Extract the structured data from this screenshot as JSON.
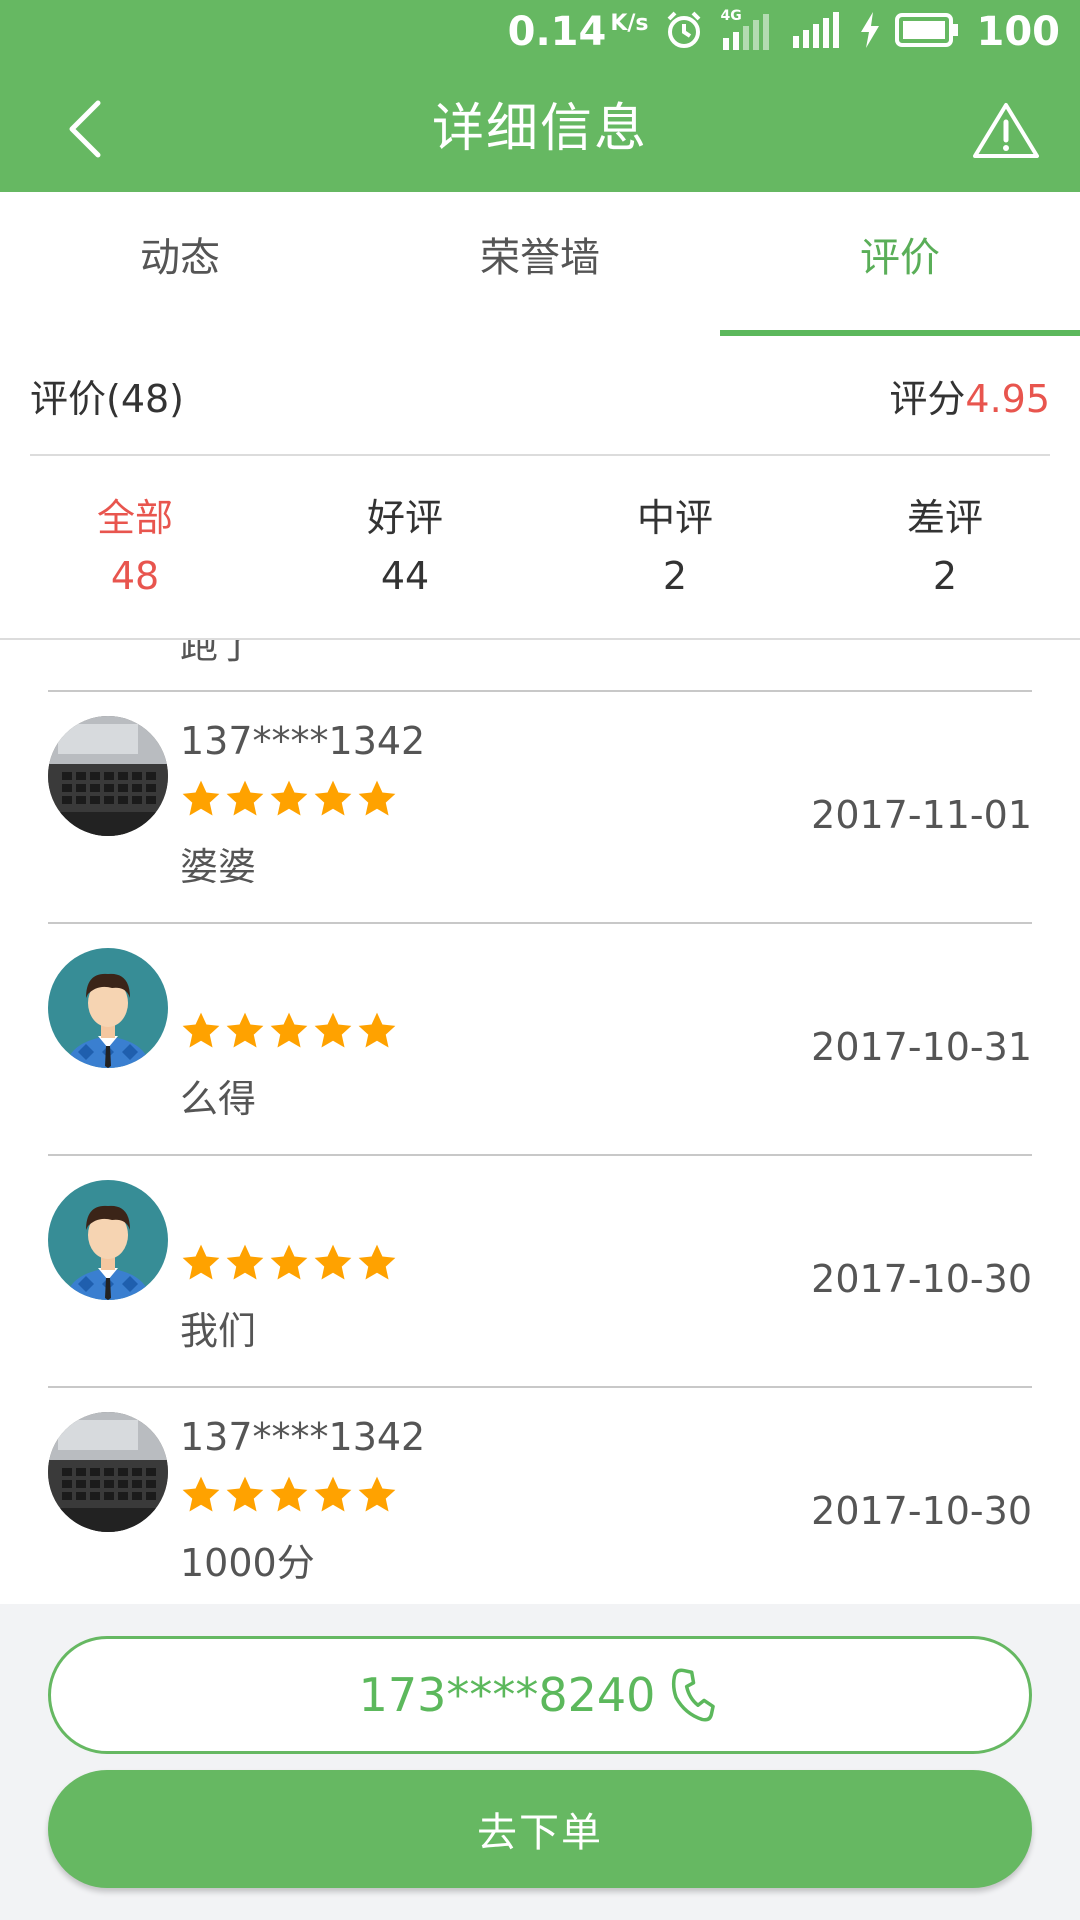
{
  "status_bar": {
    "net_speed": "0.14",
    "net_speed_unit": "K/s",
    "network_type": "4G",
    "battery": "100",
    "icons": [
      "alarm-icon",
      "signal-4g-icon",
      "signal-icon",
      "charging-icon",
      "battery-icon"
    ]
  },
  "header": {
    "title": "详细信息",
    "back_icon": "chevron-left-icon",
    "report_icon": "warning-triangle-icon"
  },
  "tabs": [
    {
      "label": "动态",
      "active": false
    },
    {
      "label": "荣誉墙",
      "active": false
    },
    {
      "label": "评价",
      "active": true
    }
  ],
  "summary": {
    "reviews_label": "评价(48)",
    "score_label": "评分",
    "score_value": "4.95"
  },
  "filters": [
    {
      "label": "全部",
      "count": "48",
      "active": true
    },
    {
      "label": "好评",
      "count": "44",
      "active": false
    },
    {
      "label": "中评",
      "count": "2",
      "active": false
    },
    {
      "label": "差评",
      "count": "2",
      "active": false
    }
  ],
  "partial_text": "跑了",
  "reviews": [
    {
      "user": "137****1342",
      "avatar": "laptop-photo",
      "stars": 5,
      "date": "2017-11-01",
      "text": "婆婆"
    },
    {
      "user": "",
      "avatar": "default-man",
      "stars": 5,
      "date": "2017-10-31",
      "text": "么得"
    },
    {
      "user": "",
      "avatar": "default-man",
      "stars": 5,
      "date": "2017-10-30",
      "text": "我们"
    },
    {
      "user": "137****1342",
      "avatar": "laptop-photo",
      "stars": 5,
      "date": "2017-10-30",
      "text": "1000分"
    }
  ],
  "bottom": {
    "phone": "173****8240",
    "phone_icon": "phone-icon",
    "order_label": "去下单"
  },
  "colors": {
    "brand_green": "#66b862",
    "accent_red": "#e8554e",
    "star_orange": "#ffa200"
  }
}
